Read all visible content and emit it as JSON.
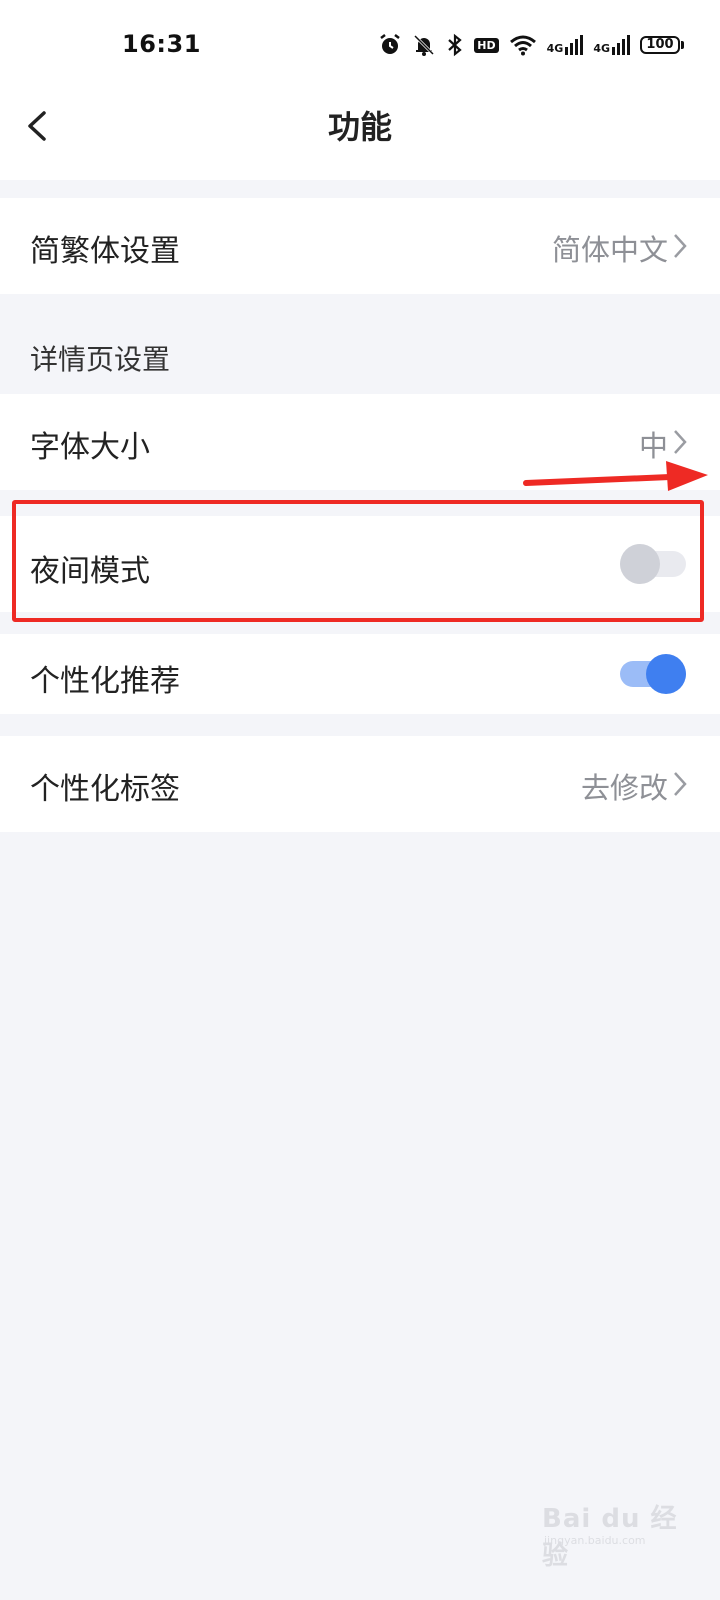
{
  "status_bar": {
    "time": "16:31",
    "icons": [
      "alarm-icon",
      "bell-off-icon",
      "bluetooth-icon",
      "hd-icon",
      "wifi-icon",
      "signal-4g-icon",
      "signal-4g-icon"
    ],
    "hd_text": "HD",
    "net_label": "4G",
    "battery": "100"
  },
  "header": {
    "title": "功能"
  },
  "settings": {
    "language": {
      "label": "简繁体设置",
      "value": "简体中文"
    },
    "detail_section_label": "详情页设置",
    "font_size": {
      "label": "字体大小",
      "value": "中"
    },
    "night_mode": {
      "label": "夜间模式",
      "enabled": false
    },
    "personalized_recommend": {
      "label": "个性化推荐",
      "enabled": true
    },
    "personalized_tags": {
      "label": "个性化标签",
      "value": "去修改"
    }
  },
  "watermark": {
    "text": "Bai du 经验",
    "sub": "jingyan.baidu.com"
  },
  "colors": {
    "accent": "#3f7ff0",
    "annotation": "#ee2a24",
    "background": "#f4f5f9"
  }
}
